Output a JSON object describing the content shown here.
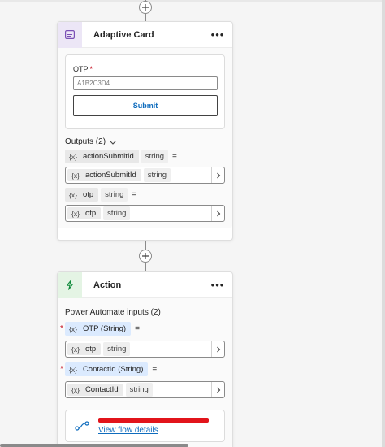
{
  "colors": {
    "adaptive_icon_bg": "#ece6f6",
    "adaptive_icon_fg": "#7a4fb5",
    "action_icon_bg": "#e4f4e4",
    "action_icon_fg": "#0e8a3a",
    "link": "#0f6cbd",
    "required": "#c50f1f"
  },
  "adaptive_card": {
    "icon": "adaptive-card-icon",
    "title": "Adaptive Card",
    "more_label": "•••",
    "preview": {
      "field_label": "OTP",
      "required_mark": "*",
      "field_placeholder": "A1B2C3D4",
      "submit_label": "Submit"
    },
    "outputs": {
      "label": "Outputs (2)",
      "items": [
        {
          "glyph": "{x}",
          "name": "actionSubmitId",
          "type": "string",
          "equals": "=",
          "value_glyph": "{x}",
          "value_name": "actionSubmitId",
          "value_type": "string"
        },
        {
          "glyph": "{x}",
          "name": "otp",
          "type": "string",
          "equals": "=",
          "value_glyph": "{x}",
          "value_name": "otp",
          "value_type": "string"
        }
      ]
    }
  },
  "action": {
    "icon": "power-automate-icon",
    "title": "Action",
    "more_label": "•••",
    "inputs": {
      "label": "Power Automate inputs (2)",
      "items": [
        {
          "required": "*",
          "glyph": "{x}",
          "name": "OTP (String)",
          "equals": "=",
          "value_glyph": "{x}",
          "value_name": "otp",
          "value_type": "string"
        },
        {
          "required": "*",
          "glyph": "{x}",
          "name": "ContactId (String)",
          "equals": "=",
          "value_glyph": "{x}",
          "value_name": "ContactId",
          "value_type": "string"
        }
      ]
    },
    "flow": {
      "icon": "flow-icon",
      "link_label": "View flow details"
    }
  }
}
